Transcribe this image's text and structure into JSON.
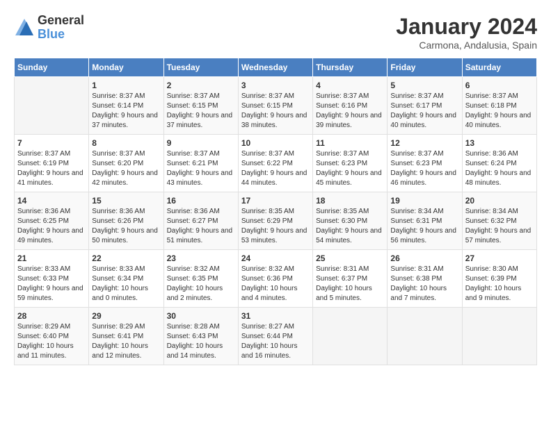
{
  "logo": {
    "general": "General",
    "blue": "Blue"
  },
  "header": {
    "month_year": "January 2024",
    "location": "Carmona, Andalusia, Spain"
  },
  "weekdays": [
    "Sunday",
    "Monday",
    "Tuesday",
    "Wednesday",
    "Thursday",
    "Friday",
    "Saturday"
  ],
  "weeks": [
    [
      {
        "day": "",
        "sunrise": "",
        "sunset": "",
        "daylight": ""
      },
      {
        "day": "1",
        "sunrise": "Sunrise: 8:37 AM",
        "sunset": "Sunset: 6:14 PM",
        "daylight": "Daylight: 9 hours and 37 minutes."
      },
      {
        "day": "2",
        "sunrise": "Sunrise: 8:37 AM",
        "sunset": "Sunset: 6:15 PM",
        "daylight": "Daylight: 9 hours and 37 minutes."
      },
      {
        "day": "3",
        "sunrise": "Sunrise: 8:37 AM",
        "sunset": "Sunset: 6:15 PM",
        "daylight": "Daylight: 9 hours and 38 minutes."
      },
      {
        "day": "4",
        "sunrise": "Sunrise: 8:37 AM",
        "sunset": "Sunset: 6:16 PM",
        "daylight": "Daylight: 9 hours and 39 minutes."
      },
      {
        "day": "5",
        "sunrise": "Sunrise: 8:37 AM",
        "sunset": "Sunset: 6:17 PM",
        "daylight": "Daylight: 9 hours and 40 minutes."
      },
      {
        "day": "6",
        "sunrise": "Sunrise: 8:37 AM",
        "sunset": "Sunset: 6:18 PM",
        "daylight": "Daylight: 9 hours and 40 minutes."
      }
    ],
    [
      {
        "day": "7",
        "sunrise": "Sunrise: 8:37 AM",
        "sunset": "Sunset: 6:19 PM",
        "daylight": "Daylight: 9 hours and 41 minutes."
      },
      {
        "day": "8",
        "sunrise": "Sunrise: 8:37 AM",
        "sunset": "Sunset: 6:20 PM",
        "daylight": "Daylight: 9 hours and 42 minutes."
      },
      {
        "day": "9",
        "sunrise": "Sunrise: 8:37 AM",
        "sunset": "Sunset: 6:21 PM",
        "daylight": "Daylight: 9 hours and 43 minutes."
      },
      {
        "day": "10",
        "sunrise": "Sunrise: 8:37 AM",
        "sunset": "Sunset: 6:22 PM",
        "daylight": "Daylight: 9 hours and 44 minutes."
      },
      {
        "day": "11",
        "sunrise": "Sunrise: 8:37 AM",
        "sunset": "Sunset: 6:23 PM",
        "daylight": "Daylight: 9 hours and 45 minutes."
      },
      {
        "day": "12",
        "sunrise": "Sunrise: 8:37 AM",
        "sunset": "Sunset: 6:23 PM",
        "daylight": "Daylight: 9 hours and 46 minutes."
      },
      {
        "day": "13",
        "sunrise": "Sunrise: 8:36 AM",
        "sunset": "Sunset: 6:24 PM",
        "daylight": "Daylight: 9 hours and 48 minutes."
      }
    ],
    [
      {
        "day": "14",
        "sunrise": "Sunrise: 8:36 AM",
        "sunset": "Sunset: 6:25 PM",
        "daylight": "Daylight: 9 hours and 49 minutes."
      },
      {
        "day": "15",
        "sunrise": "Sunrise: 8:36 AM",
        "sunset": "Sunset: 6:26 PM",
        "daylight": "Daylight: 9 hours and 50 minutes."
      },
      {
        "day": "16",
        "sunrise": "Sunrise: 8:36 AM",
        "sunset": "Sunset: 6:27 PM",
        "daylight": "Daylight: 9 hours and 51 minutes."
      },
      {
        "day": "17",
        "sunrise": "Sunrise: 8:35 AM",
        "sunset": "Sunset: 6:29 PM",
        "daylight": "Daylight: 9 hours and 53 minutes."
      },
      {
        "day": "18",
        "sunrise": "Sunrise: 8:35 AM",
        "sunset": "Sunset: 6:30 PM",
        "daylight": "Daylight: 9 hours and 54 minutes."
      },
      {
        "day": "19",
        "sunrise": "Sunrise: 8:34 AM",
        "sunset": "Sunset: 6:31 PM",
        "daylight": "Daylight: 9 hours and 56 minutes."
      },
      {
        "day": "20",
        "sunrise": "Sunrise: 8:34 AM",
        "sunset": "Sunset: 6:32 PM",
        "daylight": "Daylight: 9 hours and 57 minutes."
      }
    ],
    [
      {
        "day": "21",
        "sunrise": "Sunrise: 8:33 AM",
        "sunset": "Sunset: 6:33 PM",
        "daylight": "Daylight: 9 hours and 59 minutes."
      },
      {
        "day": "22",
        "sunrise": "Sunrise: 8:33 AM",
        "sunset": "Sunset: 6:34 PM",
        "daylight": "Daylight: 10 hours and 0 minutes."
      },
      {
        "day": "23",
        "sunrise": "Sunrise: 8:32 AM",
        "sunset": "Sunset: 6:35 PM",
        "daylight": "Daylight: 10 hours and 2 minutes."
      },
      {
        "day": "24",
        "sunrise": "Sunrise: 8:32 AM",
        "sunset": "Sunset: 6:36 PM",
        "daylight": "Daylight: 10 hours and 4 minutes."
      },
      {
        "day": "25",
        "sunrise": "Sunrise: 8:31 AM",
        "sunset": "Sunset: 6:37 PM",
        "daylight": "Daylight: 10 hours and 5 minutes."
      },
      {
        "day": "26",
        "sunrise": "Sunrise: 8:31 AM",
        "sunset": "Sunset: 6:38 PM",
        "daylight": "Daylight: 10 hours and 7 minutes."
      },
      {
        "day": "27",
        "sunrise": "Sunrise: 8:30 AM",
        "sunset": "Sunset: 6:39 PM",
        "daylight": "Daylight: 10 hours and 9 minutes."
      }
    ],
    [
      {
        "day": "28",
        "sunrise": "Sunrise: 8:29 AM",
        "sunset": "Sunset: 6:40 PM",
        "daylight": "Daylight: 10 hours and 11 minutes."
      },
      {
        "day": "29",
        "sunrise": "Sunrise: 8:29 AM",
        "sunset": "Sunset: 6:41 PM",
        "daylight": "Daylight: 10 hours and 12 minutes."
      },
      {
        "day": "30",
        "sunrise": "Sunrise: 8:28 AM",
        "sunset": "Sunset: 6:43 PM",
        "daylight": "Daylight: 10 hours and 14 minutes."
      },
      {
        "day": "31",
        "sunrise": "Sunrise: 8:27 AM",
        "sunset": "Sunset: 6:44 PM",
        "daylight": "Daylight: 10 hours and 16 minutes."
      },
      {
        "day": "",
        "sunrise": "",
        "sunset": "",
        "daylight": ""
      },
      {
        "day": "",
        "sunrise": "",
        "sunset": "",
        "daylight": ""
      },
      {
        "day": "",
        "sunrise": "",
        "sunset": "",
        "daylight": ""
      }
    ]
  ]
}
